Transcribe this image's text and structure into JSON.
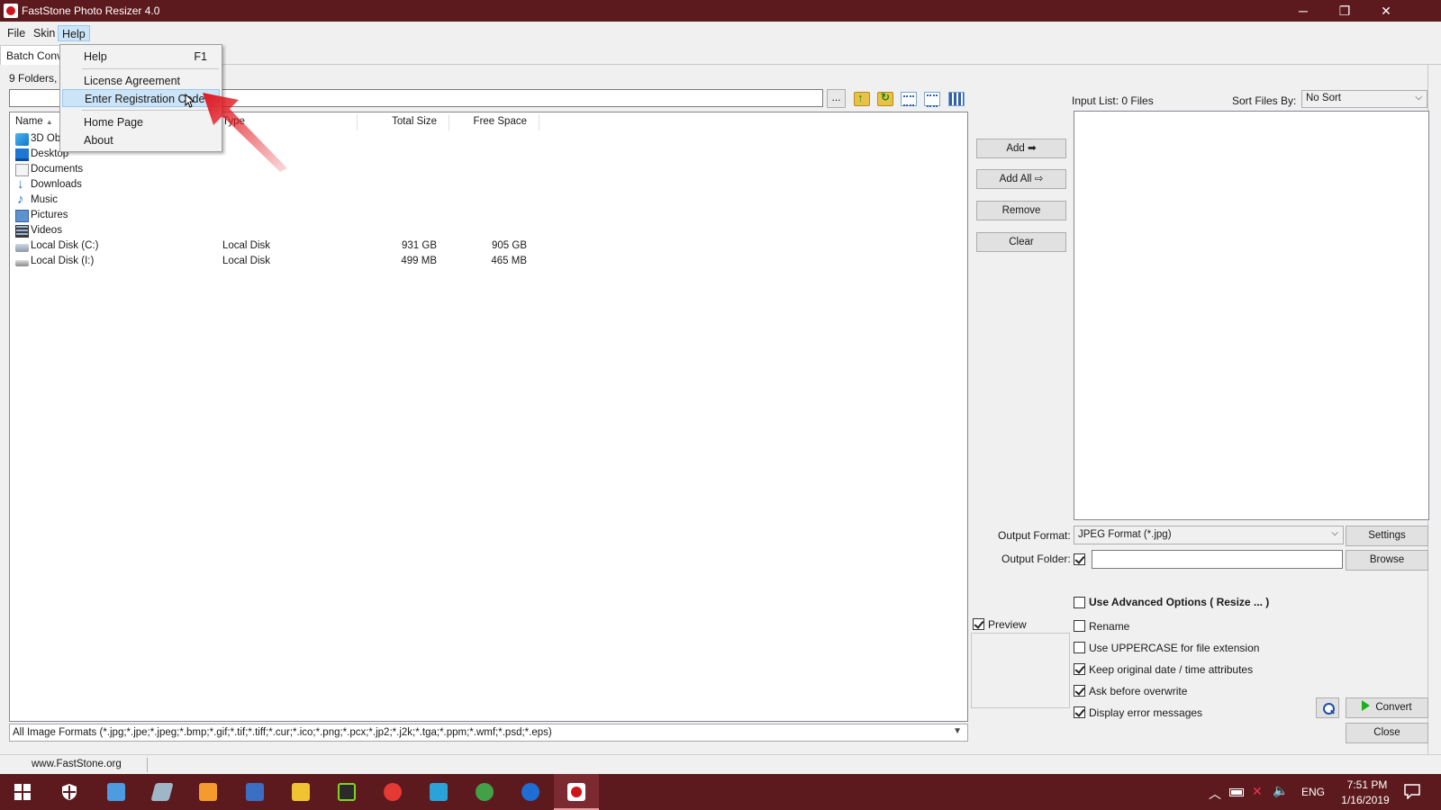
{
  "window": {
    "title": "FastStone Photo Resizer 4.0",
    "controls": [
      "─",
      "❐",
      "✕"
    ]
  },
  "menubar": {
    "items": [
      "File",
      "Skin",
      "Help"
    ]
  },
  "help_menu": {
    "items": [
      {
        "label": "Help",
        "shortcut": "F1"
      },
      {
        "label": "License Agreement"
      },
      {
        "label": "Enter Registration Code"
      },
      {
        "label": "Home Page"
      },
      {
        "label": "About"
      }
    ]
  },
  "tabs": {
    "batch": "Batch Conv"
  },
  "folder_info": "9 Folders,",
  "path": {
    "value": "",
    "browse_label": "..."
  },
  "file_list": {
    "columns": [
      "Name",
      "Type",
      "Total Size",
      "Free Space"
    ],
    "rows": [
      {
        "name": "3D Ob",
        "icon": "3d-objects-icon",
        "type": "",
        "total": "",
        "free": ""
      },
      {
        "name": "Desktop",
        "icon": "desktop-icon",
        "type": "",
        "total": "",
        "free": ""
      },
      {
        "name": "Documents",
        "icon": "documents-icon",
        "type": "",
        "total": "",
        "free": ""
      },
      {
        "name": "Downloads",
        "icon": "downloads-icon",
        "type": "",
        "total": "",
        "free": ""
      },
      {
        "name": "Music",
        "icon": "music-icon",
        "type": "",
        "total": "",
        "free": ""
      },
      {
        "name": "Pictures",
        "icon": "pictures-icon",
        "type": "",
        "total": "",
        "free": ""
      },
      {
        "name": "Videos",
        "icon": "videos-icon",
        "type": "",
        "total": "",
        "free": ""
      },
      {
        "name": "Local Disk (C:)",
        "icon": "hard-disk-icon",
        "type": "Local Disk",
        "total": "931 GB",
        "free": "905 GB"
      },
      {
        "name": "Local Disk (I:)",
        "icon": "removable-disk-icon",
        "type": "Local Disk",
        "total": "499 MB",
        "free": "465 MB"
      }
    ]
  },
  "filter": "All Image Formats (*.jpg;*.jpe;*.jpeg;*.bmp;*.gif;*.tif;*.tiff;*.cur;*.ico;*.png;*.pcx;*.jp2;*.j2k;*.tga;*.ppm;*.wmf;*.psd;*.eps)",
  "middle_buttons": {
    "add": "Add",
    "add_all": "Add All",
    "remove": "Remove",
    "clear": "Clear"
  },
  "input_list": {
    "label": "Input List:  0 Files",
    "sort_label": "Sort Files By:",
    "sort_value": "No Sort"
  },
  "output": {
    "format_label": "Output Format:",
    "format_value": "JPEG Format (*.jpg)",
    "settings": "Settings",
    "folder_label": "Output Folder:",
    "folder_value": "",
    "browse": "Browse"
  },
  "options": {
    "advanced": "Use Advanced Options ( Resize ... )",
    "rename": "Rename",
    "uppercase": "Use UPPERCASE for file extension",
    "keep_date": "Keep original date / time attributes",
    "ask_overwrite": "Ask before overwrite",
    "display_errors": "Display error messages"
  },
  "preview_label": "Preview",
  "actions": {
    "convert": "Convert",
    "close": "Close"
  },
  "status": {
    "url": "www.FastStone.org"
  },
  "taskbar": {
    "lang": "ENG",
    "time": "7:51 PM",
    "date": "1/16/2019"
  },
  "colors": {
    "titlebar": "#5c1a1e",
    "menu_highlight": "#cce4f7",
    "arrow": "#e0161e"
  }
}
